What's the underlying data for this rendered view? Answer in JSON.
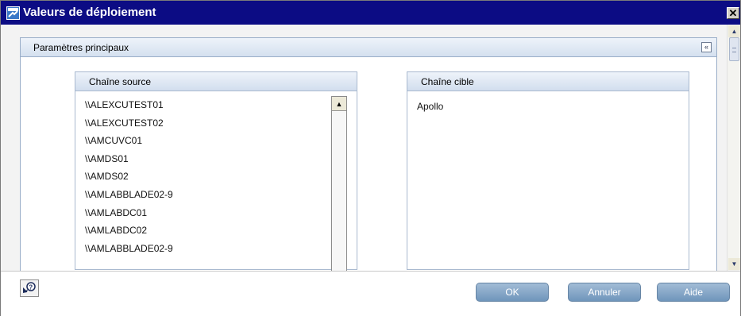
{
  "window": {
    "title": "Valeurs de déploiement",
    "close_glyph": "✕",
    "title_icon": "app-window-icon"
  },
  "section": {
    "title": "Paramètres principaux",
    "collapse_glyph": "«"
  },
  "source": {
    "title": "Chaîne source",
    "items": [
      "\\\\ALEXCUTEST01",
      "\\\\ALEXCUTEST02",
      "\\\\AMCUVC01",
      "\\\\AMDS01",
      "\\\\AMDS02",
      "\\\\AMLABBLADE02-9",
      "\\\\AMLABDC01",
      "\\\\AMLABDC02",
      "\\\\AMLABBLADE02-9"
    ]
  },
  "target": {
    "title": "Chaîne cible",
    "items": [
      "Apollo"
    ]
  },
  "footer": {
    "ok_label": "OK",
    "cancel_label": "Annuler",
    "help_label": "Aide"
  },
  "colors": {
    "titlebar": "#0c0c84",
    "button_gradient_top": "#a2bcd6",
    "button_gradient_bottom": "#6f95bb",
    "panel_header": "#d4e0ef"
  }
}
